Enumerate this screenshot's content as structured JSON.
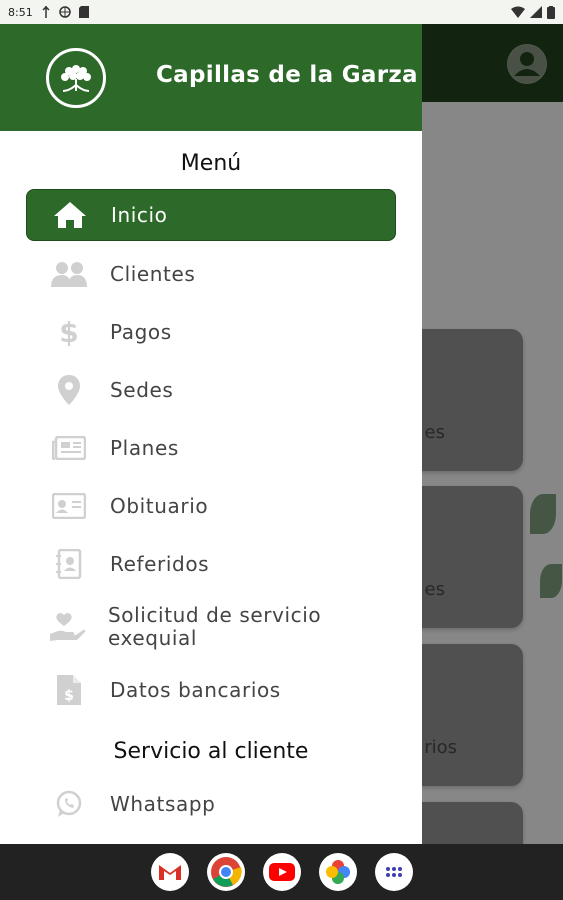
{
  "status_bar": {
    "time": "8:51"
  },
  "drawer": {
    "brand_title": "Capillas de la Garza",
    "menu_title": "Menú",
    "items": [
      {
        "label": "Inicio",
        "icon": "home-icon",
        "active": true
      },
      {
        "label": "Clientes",
        "icon": "users-icon"
      },
      {
        "label": "Pagos",
        "icon": "dollar-icon"
      },
      {
        "label": "Sedes",
        "icon": "location-pin-icon"
      },
      {
        "label": "Planes",
        "icon": "newspaper-icon"
      },
      {
        "label": "Obituario",
        "icon": "id-card-icon"
      },
      {
        "label": "Referidos",
        "icon": "address-book-icon"
      },
      {
        "label": "Solicitud de servicio exequial",
        "icon": "hand-heart-icon"
      },
      {
        "label": "Datos bancarios",
        "icon": "file-invoice-dollar-icon"
      }
    ],
    "customer_service_title": "Servicio al cliente",
    "service_items": [
      {
        "label": "Whatsapp",
        "icon": "whatsapp-icon"
      }
    ]
  },
  "background": {
    "card_texts": [
      "es",
      "es",
      "rios"
    ]
  },
  "colors": {
    "primary_green": "#2d6a2a",
    "dark_green": "#1f3f1a"
  }
}
